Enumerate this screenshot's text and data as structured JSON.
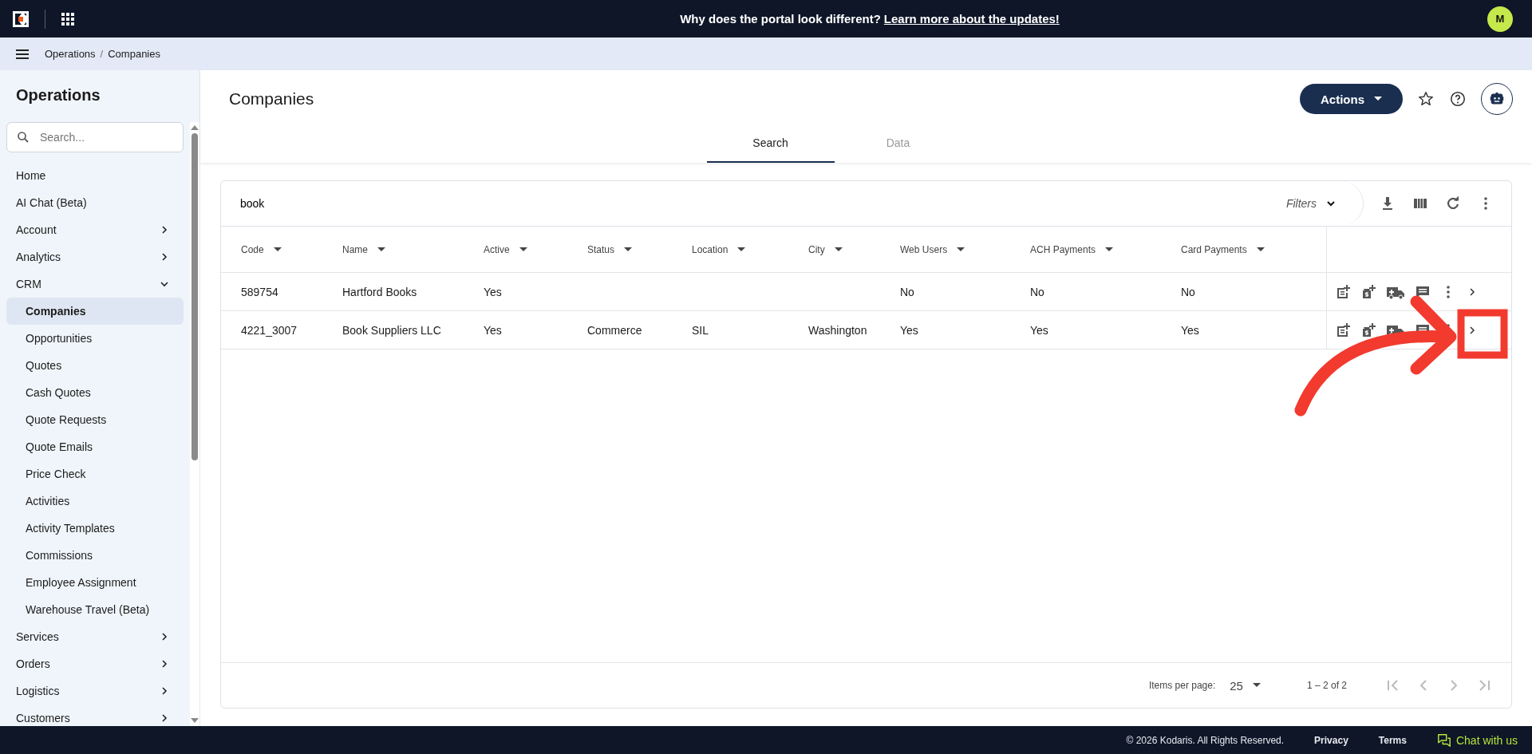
{
  "top_bar": {
    "announcement": "Why does the portal look different?",
    "link": "Learn more about the updates!",
    "avatar": "M"
  },
  "breadcrumb": {
    "items": [
      "Operations",
      "Companies"
    ],
    "separator": "/"
  },
  "sidebar": {
    "title": "Operations",
    "search": {
      "placeholder": "Search..."
    },
    "items": [
      {
        "label": "Home",
        "kind": "link",
        "selected": false
      },
      {
        "label": "AI Chat (Beta)",
        "kind": "link",
        "selected": false
      },
      {
        "label": "Account",
        "kind": "group",
        "expanded": false,
        "selected": false
      },
      {
        "label": "Analytics",
        "kind": "group",
        "expanded": false,
        "selected": false
      },
      {
        "label": "CRM",
        "kind": "group",
        "expanded": true,
        "selected": false,
        "children": [
          {
            "label": "Companies",
            "selected": true
          },
          {
            "label": "Opportunities",
            "selected": false
          },
          {
            "label": "Quotes",
            "selected": false
          },
          {
            "label": "Cash Quotes",
            "selected": false
          },
          {
            "label": "Quote Requests",
            "selected": false
          },
          {
            "label": "Quote Emails",
            "selected": false
          },
          {
            "label": "Price Check",
            "selected": false
          },
          {
            "label": "Activities",
            "selected": false
          },
          {
            "label": "Activity Templates",
            "selected": false
          },
          {
            "label": "Commissions",
            "selected": false
          },
          {
            "label": "Employee Assignment",
            "selected": false
          },
          {
            "label": "Warehouse Travel (Beta)",
            "selected": false
          }
        ]
      },
      {
        "label": "Services",
        "kind": "group",
        "expanded": false,
        "selected": false
      },
      {
        "label": "Orders",
        "kind": "group",
        "expanded": false,
        "selected": false
      },
      {
        "label": "Logistics",
        "kind": "group",
        "expanded": false,
        "selected": false
      },
      {
        "label": "Customers",
        "kind": "group",
        "expanded": false,
        "selected": false
      }
    ]
  },
  "page": {
    "title": "Companies",
    "actions_button": "Actions",
    "tabs": [
      {
        "label": "Search",
        "selected": true
      },
      {
        "label": "Data",
        "selected": false
      }
    ]
  },
  "table": {
    "search_value": "book",
    "filters": "Filters",
    "columns": [
      "Code",
      "Name",
      "Active",
      "Status",
      "Location",
      "City",
      "Web Users",
      "ACH Payments",
      "Card Payments"
    ],
    "rows": [
      {
        "cells": [
          "589754",
          "Hartford Books",
          "Yes",
          "",
          "",
          "",
          "No",
          "No",
          "No"
        ]
      },
      {
        "cells": [
          "4221_3007",
          "Book Suppliers LLC",
          "Yes",
          "Commerce",
          "SIL",
          "Washington",
          "Yes",
          "Yes",
          "Yes"
        ]
      }
    ]
  },
  "pagination": {
    "items_per_page_label": "Items per page:",
    "page_size": "25",
    "range": "1 – 2 of 2"
  },
  "footer": {
    "copyright": "© 2026 Kodaris. All Rights Reserved.",
    "links": [
      "Privacy",
      "Terms"
    ],
    "chat": "Chat with us"
  }
}
